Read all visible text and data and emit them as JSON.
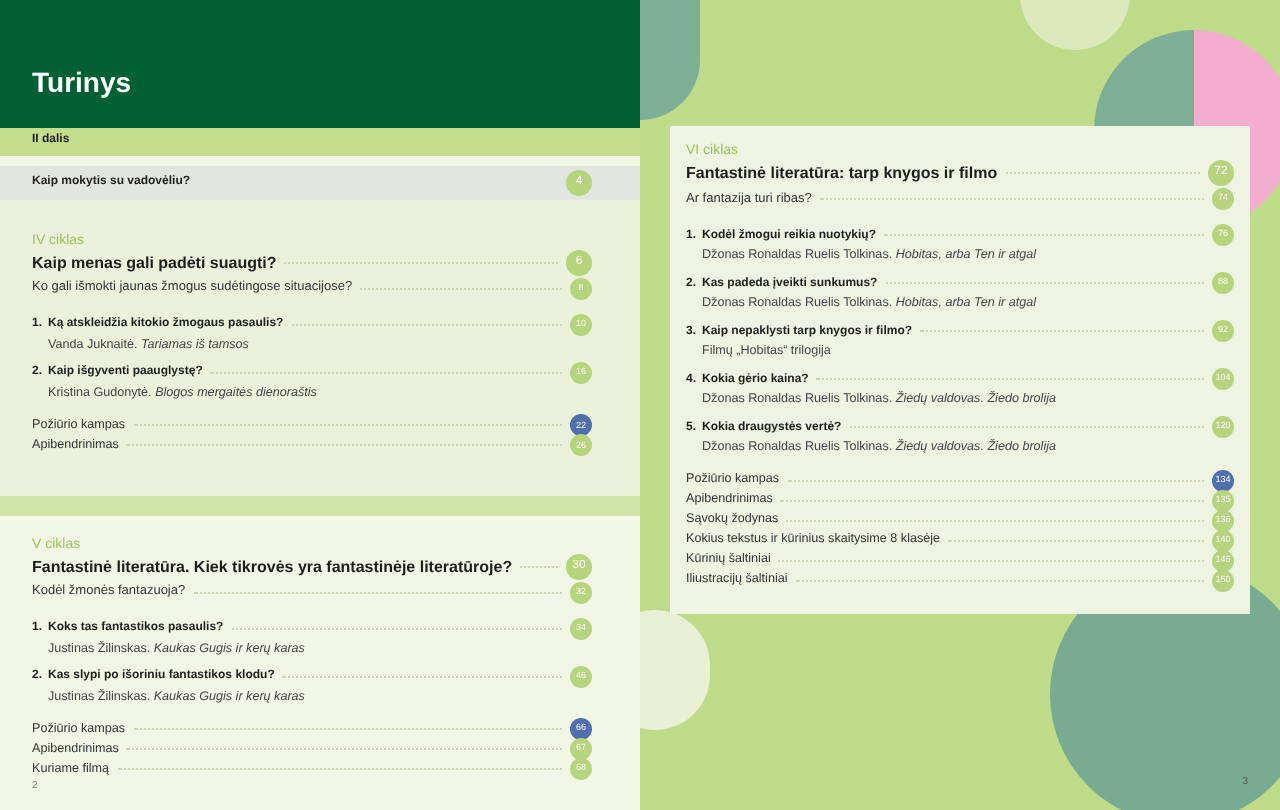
{
  "left_page": {
    "title": "Turinys",
    "part_label": "II dalis",
    "intro": {
      "title": "Kaip mokytis su vadovėliu?",
      "page": "4"
    },
    "sections": [
      {
        "cycle": "IV ciklas",
        "title": "Kaip menas gali padėti suaugti?",
        "page": "6",
        "subtitle": "Ko gali išmokti jaunas žmogus sudėtingose situacijose?",
        "subtitle_page": "8",
        "lessons": [
          {
            "number": "1.",
            "title": "Ką atskleidžia kitokio žmogaus pasaulis?",
            "work": "Vanda Juknaitė. *Tariamas iš tamsos*",
            "page": "10"
          },
          {
            "number": "2.",
            "title": "Kaip išgyventi paauglystę?",
            "work": "Kristina Gudonytė. *Blogos mergaitės dienoraštis*",
            "page": "16"
          }
        ],
        "extras": [
          {
            "label": "Požiūrio kampas",
            "page": "22",
            "highlighted": true
          },
          {
            "label": "Apibendrinimas",
            "page": "26",
            "highlighted": false
          }
        ]
      },
      {
        "cycle": "V ciklas",
        "title": "Fantastinė literatūra. Kiek tikrovės yra fantastinėje literatūroje?",
        "page": "30",
        "subtitle": "Kodėl žmonės fantazuoja?",
        "subtitle_page": "32",
        "lessons": [
          {
            "number": "1.",
            "title": "Koks tas fantastikos pasaulis?",
            "work": "Justinas Žilinskas. *Kaukas Gugis ir kerų karas*",
            "page": "34"
          },
          {
            "number": "2.",
            "title": "Kas slypi po išoriniu fantastikos klodu?",
            "work": "Justinas Žilinskas. *Kaukas Gugis ir kerų karas*",
            "page": "46"
          }
        ],
        "extras": [
          {
            "label": "Požiūrio kampas",
            "page": "66",
            "highlighted": true
          },
          {
            "label": "Apibendrinimas",
            "page": "67",
            "highlighted": false
          },
          {
            "label": "Kuriame filmą",
            "page": "68",
            "highlighted": false
          }
        ]
      }
    ],
    "page_number": "2"
  },
  "right_page": {
    "section": {
      "cycle": "VI ciklas",
      "title": "Fantastinė literatūra: tarp knygos ir filmo",
      "page": "72",
      "subtitle": "Ar fantazija turi ribas?",
      "subtitle_page": "74",
      "lessons": [
        {
          "number": "1.",
          "title": "Kodėl žmogui reikia nuotykių?",
          "work": "Džonas Ronaldas Ruelis Tolkinas. *Hobitas, arba Ten ir atgal*",
          "page": "76"
        },
        {
          "number": "2.",
          "title": "Kas padeda įveikti sunkumus?",
          "work": "Džonas Ronaldas Ruelis Tolkinas. *Hobitas, arba Ten ir atgal*",
          "page": "88"
        },
        {
          "number": "3.",
          "title": "Kaip nepaklysti tarp knygos ir filmo?",
          "work": "Filmų „Hobitas“ trilogija",
          "page": "92"
        },
        {
          "number": "4.",
          "title": "Kokia gėrio kaina?",
          "work": "Džonas Ronaldas Ruelis Tolkinas. *Žiedų valdovas. Žiedo brolija*",
          "page": "104"
        },
        {
          "number": "5.",
          "title": "Kokia draugystės vertė?",
          "work": "Džonas Ronaldas Ruelis Tolkinas. *Žiedų valdovas. Žiedo brolija*",
          "page": "120"
        }
      ],
      "extras": [
        {
          "label": "Požiūrio kampas",
          "page": "134",
          "highlighted": true
        },
        {
          "label": "Apibendrinimas",
          "page": "135",
          "highlighted": false
        },
        {
          "label": "Sąvokų žodynas",
          "page": "136",
          "highlighted": false
        },
        {
          "label": "Kokius tekstus ir kūrinius skaitysime 8 klasėje",
          "page": "140",
          "highlighted": false
        },
        {
          "label": "Kūrinių šaltiniai",
          "page": "146",
          "highlighted": false
        },
        {
          "label": "Iliustracijų šaltiniai",
          "page": "150",
          "highlighted": false
        }
      ]
    },
    "page_number": "3"
  }
}
